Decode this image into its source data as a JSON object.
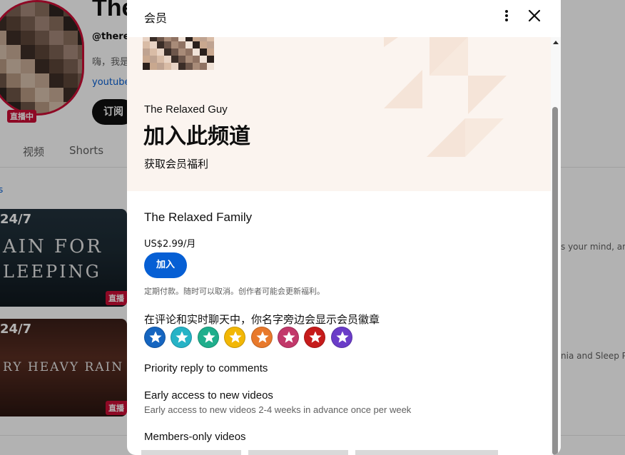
{
  "background": {
    "channel_title": "The",
    "handle": "@therel",
    "description": "嗨，我是",
    "link": "youtube",
    "live_badge": "直播中",
    "subscribe": "订阅",
    "tabs": [
      "视频",
      "Shorts"
    ],
    "side_link": "s",
    "thumb1": {
      "tag": "24/7",
      "line1": "AIN FOR",
      "line2": "LEEPING",
      "live": "直播"
    },
    "thumb2": {
      "tag": "24/7",
      "line1": "RY HEAVY RAIN",
      "live": "直播"
    },
    "right_text1": "s your mind, and",
    "right_text2": "nia and Sleep Pe"
  },
  "dialog": {
    "title": "会员",
    "more_icon": "more-vert-icon",
    "close_icon": "close-icon",
    "hero": {
      "channel": "The Relaxed Guy",
      "headline": "加入此频道",
      "subtitle": "获取会员福利"
    },
    "tier": {
      "name": "The Relaxed Family",
      "price": "US$2.99/月",
      "join_label": "加入",
      "terms": "定期付款。随时可以取消。创作者可能会更新福利。"
    },
    "badges": {
      "heading": "在评论和实时聊天中，你名字旁边会显示会员徽章",
      "colors": [
        "#1565c0",
        "#26b3c6",
        "#1fae8c",
        "#f2b705",
        "#e8792b",
        "#c2386a",
        "#c61b1b",
        "#6a3cc8"
      ]
    },
    "perks": [
      {
        "title": "Priority reply to comments",
        "desc": ""
      },
      {
        "title": "Early access to new videos",
        "desc": "Early access to new videos 2-4 weeks in advance once per week"
      },
      {
        "title": "Members-only videos",
        "desc": ""
      }
    ]
  },
  "colors": {
    "accent": "#065fd4",
    "live_red": "#cc0e35",
    "hero_bg": "#fbf4ef"
  }
}
